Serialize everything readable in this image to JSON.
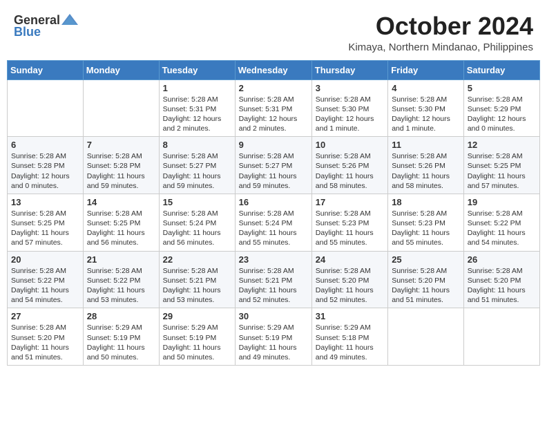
{
  "header": {
    "logo_general": "General",
    "logo_blue": "Blue",
    "month": "October 2024",
    "location": "Kimaya, Northern Mindanao, Philippines"
  },
  "days_of_week": [
    "Sunday",
    "Monday",
    "Tuesday",
    "Wednesday",
    "Thursday",
    "Friday",
    "Saturday"
  ],
  "weeks": [
    [
      {
        "day": "",
        "info": ""
      },
      {
        "day": "",
        "info": ""
      },
      {
        "day": "1",
        "sunrise": "Sunrise: 5:28 AM",
        "sunset": "Sunset: 5:31 PM",
        "daylight": "Daylight: 12 hours and 2 minutes."
      },
      {
        "day": "2",
        "sunrise": "Sunrise: 5:28 AM",
        "sunset": "Sunset: 5:31 PM",
        "daylight": "Daylight: 12 hours and 2 minutes."
      },
      {
        "day": "3",
        "sunrise": "Sunrise: 5:28 AM",
        "sunset": "Sunset: 5:30 PM",
        "daylight": "Daylight: 12 hours and 1 minute."
      },
      {
        "day": "4",
        "sunrise": "Sunrise: 5:28 AM",
        "sunset": "Sunset: 5:30 PM",
        "daylight": "Daylight: 12 hours and 1 minute."
      },
      {
        "day": "5",
        "sunrise": "Sunrise: 5:28 AM",
        "sunset": "Sunset: 5:29 PM",
        "daylight": "Daylight: 12 hours and 0 minutes."
      }
    ],
    [
      {
        "day": "6",
        "sunrise": "Sunrise: 5:28 AM",
        "sunset": "Sunset: 5:28 PM",
        "daylight": "Daylight: 12 hours and 0 minutes."
      },
      {
        "day": "7",
        "sunrise": "Sunrise: 5:28 AM",
        "sunset": "Sunset: 5:28 PM",
        "daylight": "Daylight: 11 hours and 59 minutes."
      },
      {
        "day": "8",
        "sunrise": "Sunrise: 5:28 AM",
        "sunset": "Sunset: 5:27 PM",
        "daylight": "Daylight: 11 hours and 59 minutes."
      },
      {
        "day": "9",
        "sunrise": "Sunrise: 5:28 AM",
        "sunset": "Sunset: 5:27 PM",
        "daylight": "Daylight: 11 hours and 59 minutes."
      },
      {
        "day": "10",
        "sunrise": "Sunrise: 5:28 AM",
        "sunset": "Sunset: 5:26 PM",
        "daylight": "Daylight: 11 hours and 58 minutes."
      },
      {
        "day": "11",
        "sunrise": "Sunrise: 5:28 AM",
        "sunset": "Sunset: 5:26 PM",
        "daylight": "Daylight: 11 hours and 58 minutes."
      },
      {
        "day": "12",
        "sunrise": "Sunrise: 5:28 AM",
        "sunset": "Sunset: 5:25 PM",
        "daylight": "Daylight: 11 hours and 57 minutes."
      }
    ],
    [
      {
        "day": "13",
        "sunrise": "Sunrise: 5:28 AM",
        "sunset": "Sunset: 5:25 PM",
        "daylight": "Daylight: 11 hours and 57 minutes."
      },
      {
        "day": "14",
        "sunrise": "Sunrise: 5:28 AM",
        "sunset": "Sunset: 5:25 PM",
        "daylight": "Daylight: 11 hours and 56 minutes."
      },
      {
        "day": "15",
        "sunrise": "Sunrise: 5:28 AM",
        "sunset": "Sunset: 5:24 PM",
        "daylight": "Daylight: 11 hours and 56 minutes."
      },
      {
        "day": "16",
        "sunrise": "Sunrise: 5:28 AM",
        "sunset": "Sunset: 5:24 PM",
        "daylight": "Daylight: 11 hours and 55 minutes."
      },
      {
        "day": "17",
        "sunrise": "Sunrise: 5:28 AM",
        "sunset": "Sunset: 5:23 PM",
        "daylight": "Daylight: 11 hours and 55 minutes."
      },
      {
        "day": "18",
        "sunrise": "Sunrise: 5:28 AM",
        "sunset": "Sunset: 5:23 PM",
        "daylight": "Daylight: 11 hours and 55 minutes."
      },
      {
        "day": "19",
        "sunrise": "Sunrise: 5:28 AM",
        "sunset": "Sunset: 5:22 PM",
        "daylight": "Daylight: 11 hours and 54 minutes."
      }
    ],
    [
      {
        "day": "20",
        "sunrise": "Sunrise: 5:28 AM",
        "sunset": "Sunset: 5:22 PM",
        "daylight": "Daylight: 11 hours and 54 minutes."
      },
      {
        "day": "21",
        "sunrise": "Sunrise: 5:28 AM",
        "sunset": "Sunset: 5:22 PM",
        "daylight": "Daylight: 11 hours and 53 minutes."
      },
      {
        "day": "22",
        "sunrise": "Sunrise: 5:28 AM",
        "sunset": "Sunset: 5:21 PM",
        "daylight": "Daylight: 11 hours and 53 minutes."
      },
      {
        "day": "23",
        "sunrise": "Sunrise: 5:28 AM",
        "sunset": "Sunset: 5:21 PM",
        "daylight": "Daylight: 11 hours and 52 minutes."
      },
      {
        "day": "24",
        "sunrise": "Sunrise: 5:28 AM",
        "sunset": "Sunset: 5:20 PM",
        "daylight": "Daylight: 11 hours and 52 minutes."
      },
      {
        "day": "25",
        "sunrise": "Sunrise: 5:28 AM",
        "sunset": "Sunset: 5:20 PM",
        "daylight": "Daylight: 11 hours and 51 minutes."
      },
      {
        "day": "26",
        "sunrise": "Sunrise: 5:28 AM",
        "sunset": "Sunset: 5:20 PM",
        "daylight": "Daylight: 11 hours and 51 minutes."
      }
    ],
    [
      {
        "day": "27",
        "sunrise": "Sunrise: 5:28 AM",
        "sunset": "Sunset: 5:20 PM",
        "daylight": "Daylight: 11 hours and 51 minutes."
      },
      {
        "day": "28",
        "sunrise": "Sunrise: 5:29 AM",
        "sunset": "Sunset: 5:19 PM",
        "daylight": "Daylight: 11 hours and 50 minutes."
      },
      {
        "day": "29",
        "sunrise": "Sunrise: 5:29 AM",
        "sunset": "Sunset: 5:19 PM",
        "daylight": "Daylight: 11 hours and 50 minutes."
      },
      {
        "day": "30",
        "sunrise": "Sunrise: 5:29 AM",
        "sunset": "Sunset: 5:19 PM",
        "daylight": "Daylight: 11 hours and 49 minutes."
      },
      {
        "day": "31",
        "sunrise": "Sunrise: 5:29 AM",
        "sunset": "Sunset: 5:18 PM",
        "daylight": "Daylight: 11 hours and 49 minutes."
      },
      {
        "day": "",
        "info": ""
      },
      {
        "day": "",
        "info": ""
      }
    ]
  ]
}
